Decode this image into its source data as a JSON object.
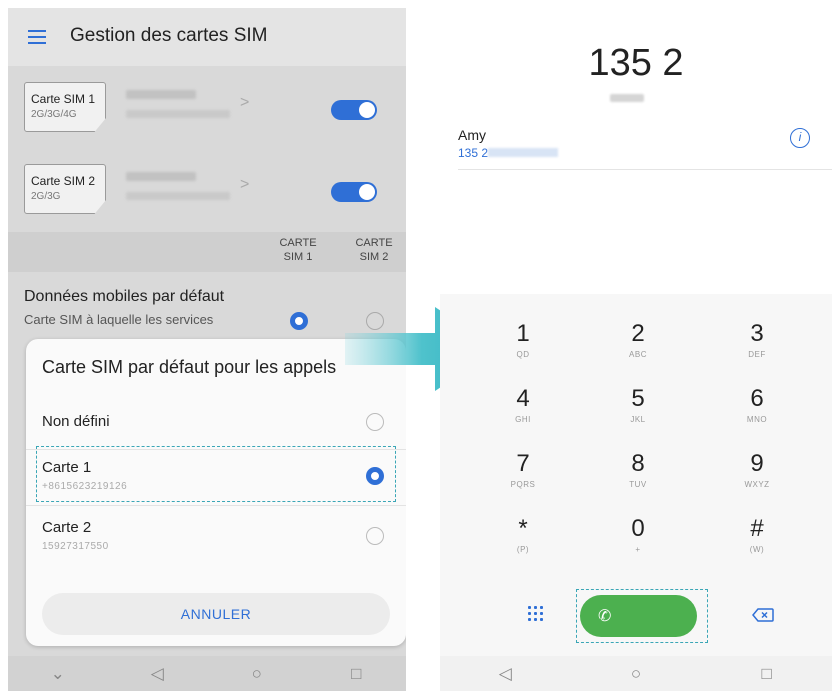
{
  "left": {
    "title": "Gestion des cartes SIM",
    "sims": [
      {
        "label": "Carte SIM 1",
        "tech": "2G/3G/4G"
      },
      {
        "label": "Carte SIM 2",
        "tech": "2G/3G"
      }
    ],
    "columns": [
      "CARTE\nSIM 1",
      "CARTE\nSIM 2"
    ],
    "data_row": {
      "title": "Données mobiles par défaut",
      "subtitle": "Carte SIM à laquelle les services"
    },
    "dialog": {
      "title": "Carte SIM par défaut pour les appels",
      "options": [
        {
          "label": "Non défini",
          "sub": "",
          "selected": false
        },
        {
          "label": "Carte 1",
          "sub": "+8615623219126",
          "selected": true
        },
        {
          "label": "Carte 2",
          "sub": "15927317550",
          "selected": false
        }
      ],
      "cancel_label": "ANNULER"
    }
  },
  "right": {
    "dialed_number": "135 2",
    "contact": {
      "name": "Amy",
      "number": "135 2"
    },
    "keys": [
      {
        "digit": "1",
        "letters": "QD"
      },
      {
        "digit": "2",
        "letters": "ABC"
      },
      {
        "digit": "3",
        "letters": "DEF"
      },
      {
        "digit": "4",
        "letters": "GHI"
      },
      {
        "digit": "5",
        "letters": "JKL"
      },
      {
        "digit": "6",
        "letters": "MNO"
      },
      {
        "digit": "7",
        "letters": "PQRS"
      },
      {
        "digit": "8",
        "letters": "TUV"
      },
      {
        "digit": "9",
        "letters": "WXYZ"
      },
      {
        "digit": "*",
        "letters": "(P)"
      },
      {
        "digit": "0",
        "letters": "+"
      },
      {
        "digit": "#",
        "letters": "(W)"
      }
    ]
  },
  "colors": {
    "accent": "#2f6fd6",
    "call_green": "#4cb04f",
    "highlight": "#3aa6b6"
  }
}
